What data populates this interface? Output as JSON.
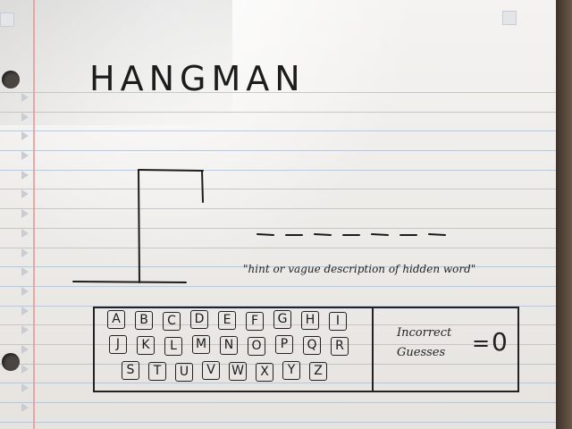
{
  "title": "HANGMAN",
  "hint": "\"hint or vague description of hidden word\"",
  "word_blanks": 7,
  "keyboard": {
    "row1": [
      "A",
      "B",
      "C",
      "D",
      "E",
      "F",
      "G",
      "H",
      "I"
    ],
    "row2": [
      "J",
      "K",
      "L",
      "M",
      "N",
      "O",
      "P",
      "Q",
      "R"
    ],
    "row3": [
      "S",
      "T",
      "U",
      "V",
      "W",
      "X",
      "Y",
      "Z"
    ]
  },
  "incorrect_guesses": {
    "label_line1": "Incorrect",
    "label_line2": "Guesses",
    "equals": "=",
    "count": "0"
  },
  "colors": {
    "ink": "#1c1c1c",
    "paper": "#f1efec",
    "rule": "#a9bcd0",
    "margin": "#e79a9a"
  }
}
